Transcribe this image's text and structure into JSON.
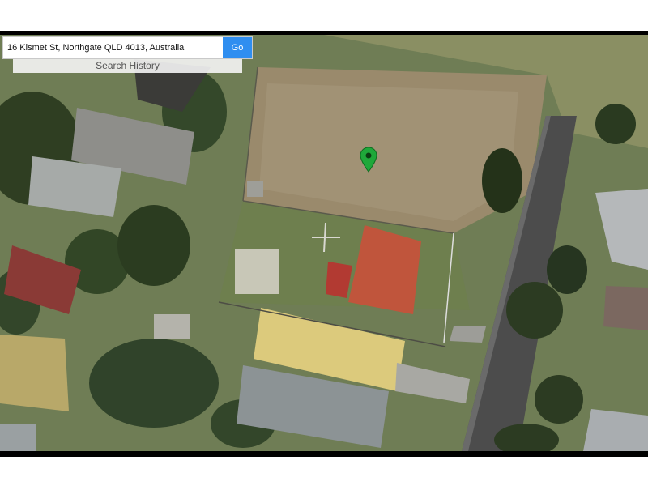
{
  "search": {
    "value": "16 Kismet St, Northgate QLD 4013, Australia",
    "go_label": "Go",
    "history_label": "Search History"
  },
  "icons": {
    "location_pin": "map-pin-icon"
  },
  "colors": {
    "go_button": "#2f8ef0",
    "pin": "#1fa83a"
  }
}
